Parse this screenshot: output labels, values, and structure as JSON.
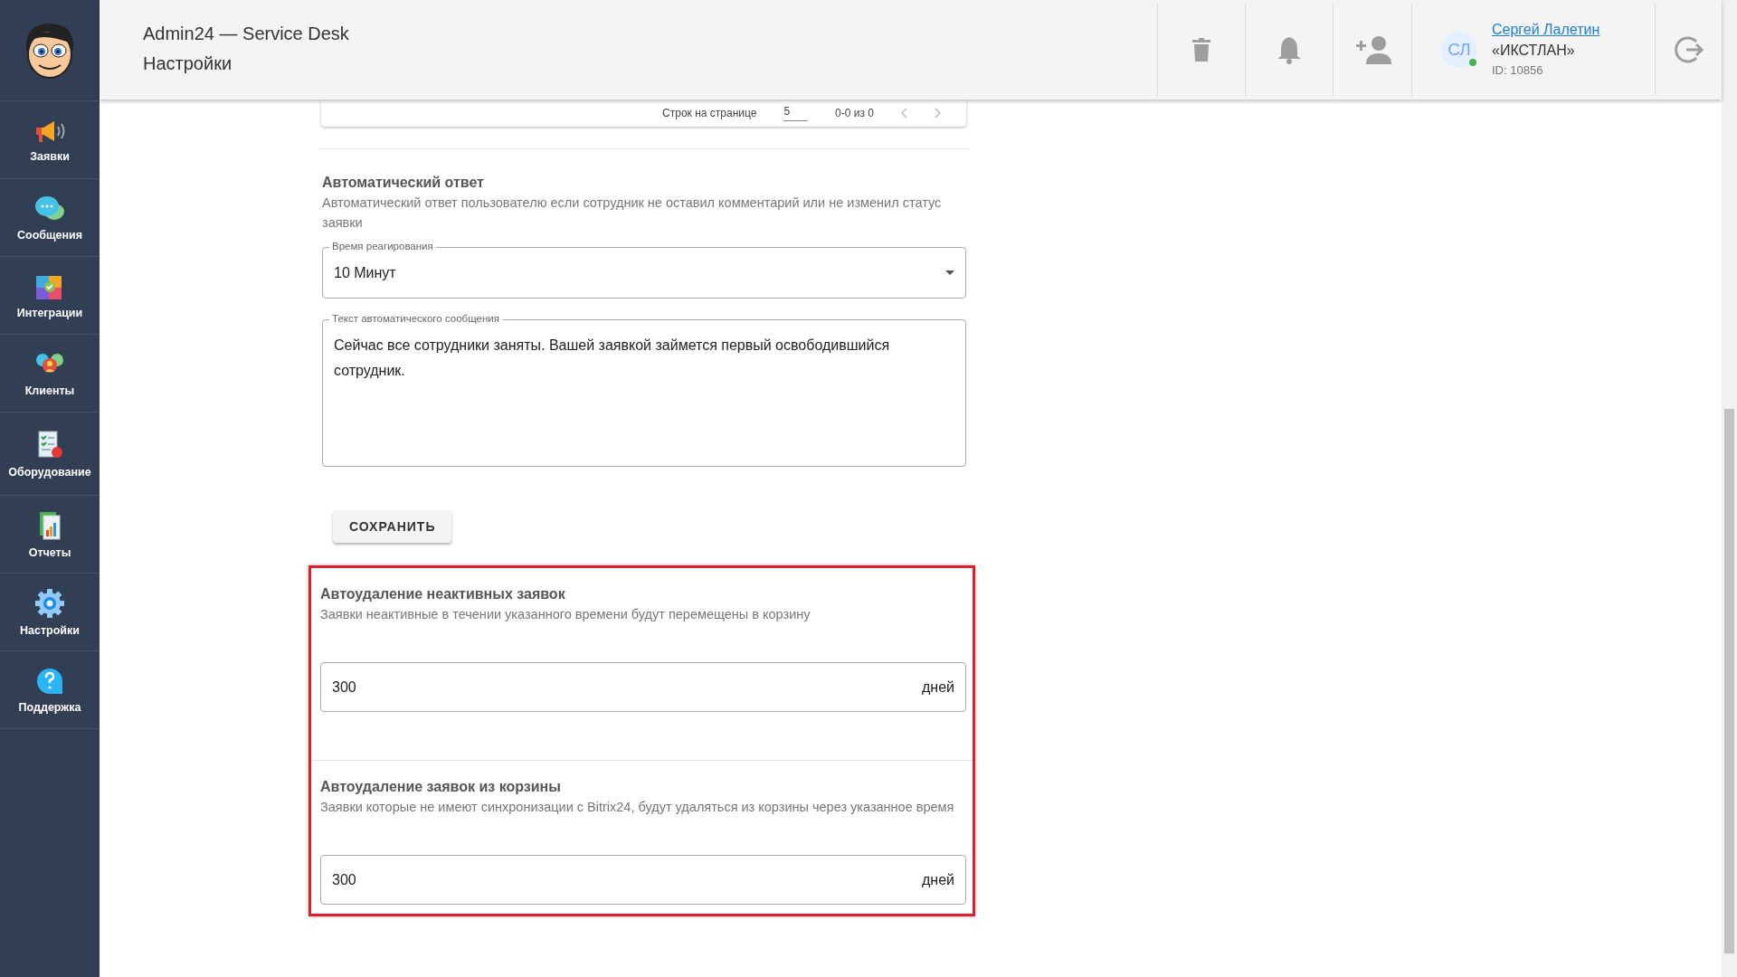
{
  "sidebar": {
    "items": [
      {
        "label": "Заявки",
        "kind": "megaphone"
      },
      {
        "label": "Сообщения",
        "kind": "chat"
      },
      {
        "label": "Интеграции",
        "kind": "puzzle"
      },
      {
        "label": "Клиенты",
        "kind": "people"
      },
      {
        "label": "Оборудование",
        "kind": "checklist"
      },
      {
        "label": "Отчеты",
        "kind": "report"
      },
      {
        "label": "Настройки",
        "kind": "gear"
      },
      {
        "label": "Поддержка",
        "kind": "help"
      }
    ]
  },
  "header": {
    "app_title": "Admin24 — Service Desk",
    "page_title": "Настройки",
    "user": {
      "initials": "СЛ",
      "online": true,
      "name": "Сергей Лалетин",
      "company": "«ИКСТЛАН»",
      "id": "ID: 10856"
    }
  },
  "pagination": {
    "rows_label": "Строк на странице",
    "rows_value": "5",
    "range": "0-0 из 0"
  },
  "auto_reply": {
    "title": "Автоматический ответ",
    "description": "Автоматический ответ пользователю если сотрудник не оставил комментарий или не изменил статус заявки",
    "reaction_label": "Время реагирования",
    "reaction_value": "10 Минут",
    "message_label": "Текст автоматического сообщения",
    "message_value": "Сейчас все сотрудники заняты. Вашей заявкой займется первый освободившийся сотрудник.",
    "save": "СОХРАНИТЬ"
  },
  "auto_delete": [
    {
      "title": "Автоудаление неактивных заявок",
      "description": "Заявки неактивные в течении указанного времени будут перемещены в корзину",
      "value": "300",
      "unit": "дней"
    },
    {
      "title": "Автоудаление заявок из корзины",
      "description": "Заявки которые не имеют синхронизации с Bitrix24, будут удаляться из корзины через указанное время",
      "value": "300",
      "unit": "дней"
    }
  ]
}
